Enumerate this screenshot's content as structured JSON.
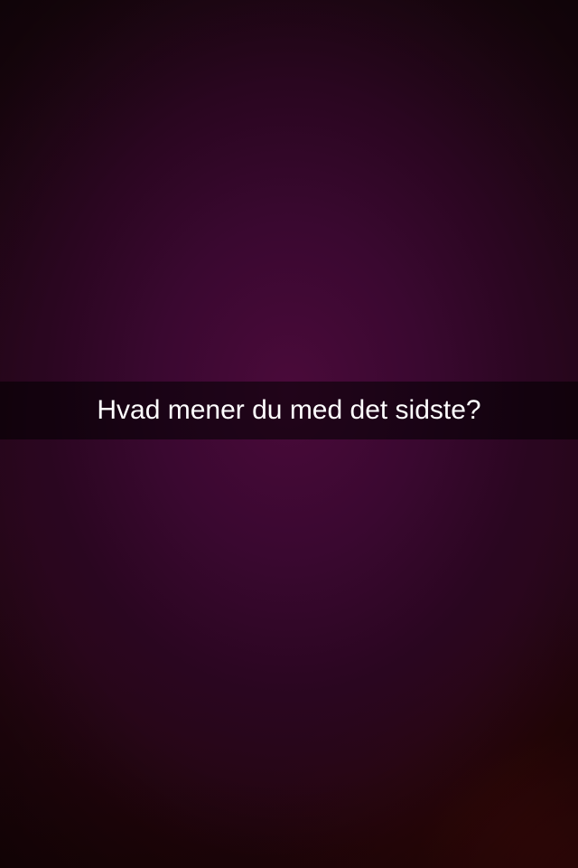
{
  "snap": {
    "caption": "Hvad mener du med det sidste?"
  }
}
